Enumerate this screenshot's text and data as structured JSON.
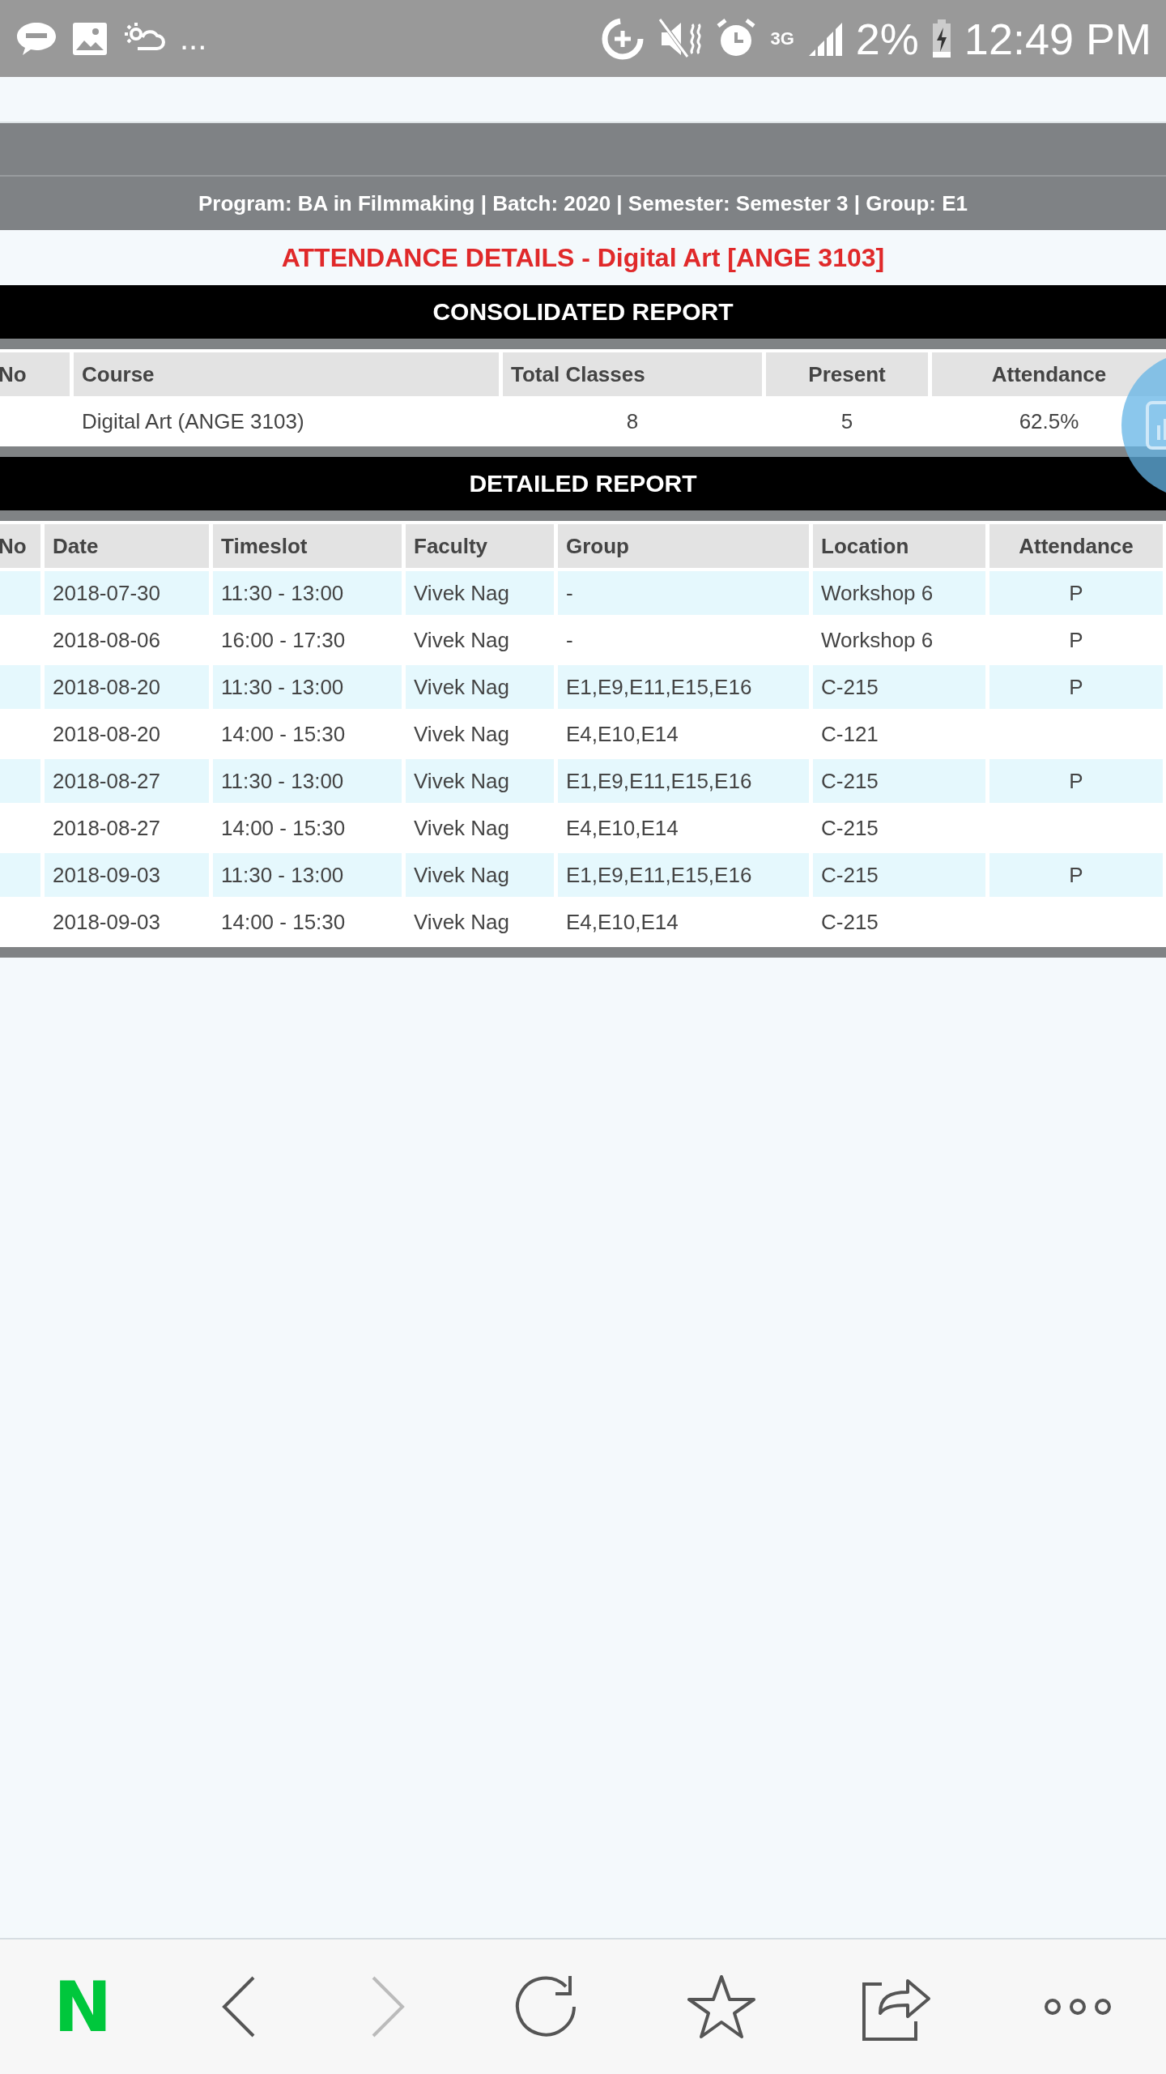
{
  "status_bar": {
    "more": "...",
    "network": "3G",
    "battery": "2%",
    "time": "12:49 PM"
  },
  "header": {
    "info": "Program: BA in Filmmaking | Batch: 2020 | Semester: Semester 3 | Group: E1"
  },
  "title": "ATTENDANCE DETAILS - Digital Art [ANGE 3103]",
  "consolidated": {
    "heading": "CONSOLIDATED REPORT",
    "columns": [
      "No",
      "Course",
      "Total Classes",
      "Present",
      "Attendance"
    ],
    "rows": [
      {
        "course": "Digital Art (ANGE 3103)",
        "total": "8",
        "present": "5",
        "attendance": "62.5%"
      }
    ]
  },
  "detailed": {
    "heading": "DETAILED REPORT",
    "columns": [
      "No",
      "Date",
      "Timeslot",
      "Faculty",
      "Group",
      "Location",
      "Attendance"
    ],
    "rows": [
      {
        "date": "2018-07-30",
        "timeslot": "11:30 - 13:00",
        "faculty": "Vivek Nag",
        "group": "-",
        "location": "Workshop 6",
        "attendance": "P"
      },
      {
        "date": "2018-08-06",
        "timeslot": "16:00 - 17:30",
        "faculty": "Vivek Nag",
        "group": "-",
        "location": "Workshop 6",
        "attendance": "P"
      },
      {
        "date": "2018-08-20",
        "timeslot": "11:30 - 13:00",
        "faculty": "Vivek Nag",
        "group": "E1,E9,E11,E15,E16",
        "location": "C-215",
        "attendance": "P"
      },
      {
        "date": "2018-08-20",
        "timeslot": "14:00 - 15:30",
        "faculty": "Vivek Nag",
        "group": "E4,E10,E14",
        "location": "C-121"
      },
      {
        "date": "2018-08-27",
        "timeslot": "11:30 - 13:00",
        "faculty": "Vivek Nag",
        "group": "E1,E9,E11,E15,E16",
        "location": "C-215",
        "attendance": "P"
      },
      {
        "date": "2018-08-27",
        "timeslot": "14:00 - 15:30",
        "faculty": "Vivek Nag",
        "group": "E4,E10,E14",
        "location": "C-215"
      },
      {
        "date": "2018-09-03",
        "timeslot": "11:30 - 13:00",
        "faculty": "Vivek Nag",
        "group": "E1,E9,E11,E15,E16",
        "location": "C-215",
        "attendance": "P"
      },
      {
        "date": "2018-09-03",
        "timeslot": "14:00 - 15:30",
        "faculty": "Vivek Nag",
        "group": "E4,E10,E14",
        "location": "C-215"
      }
    ]
  },
  "browser_bar": {
    "logo": "N",
    "forward_disabled": true
  }
}
